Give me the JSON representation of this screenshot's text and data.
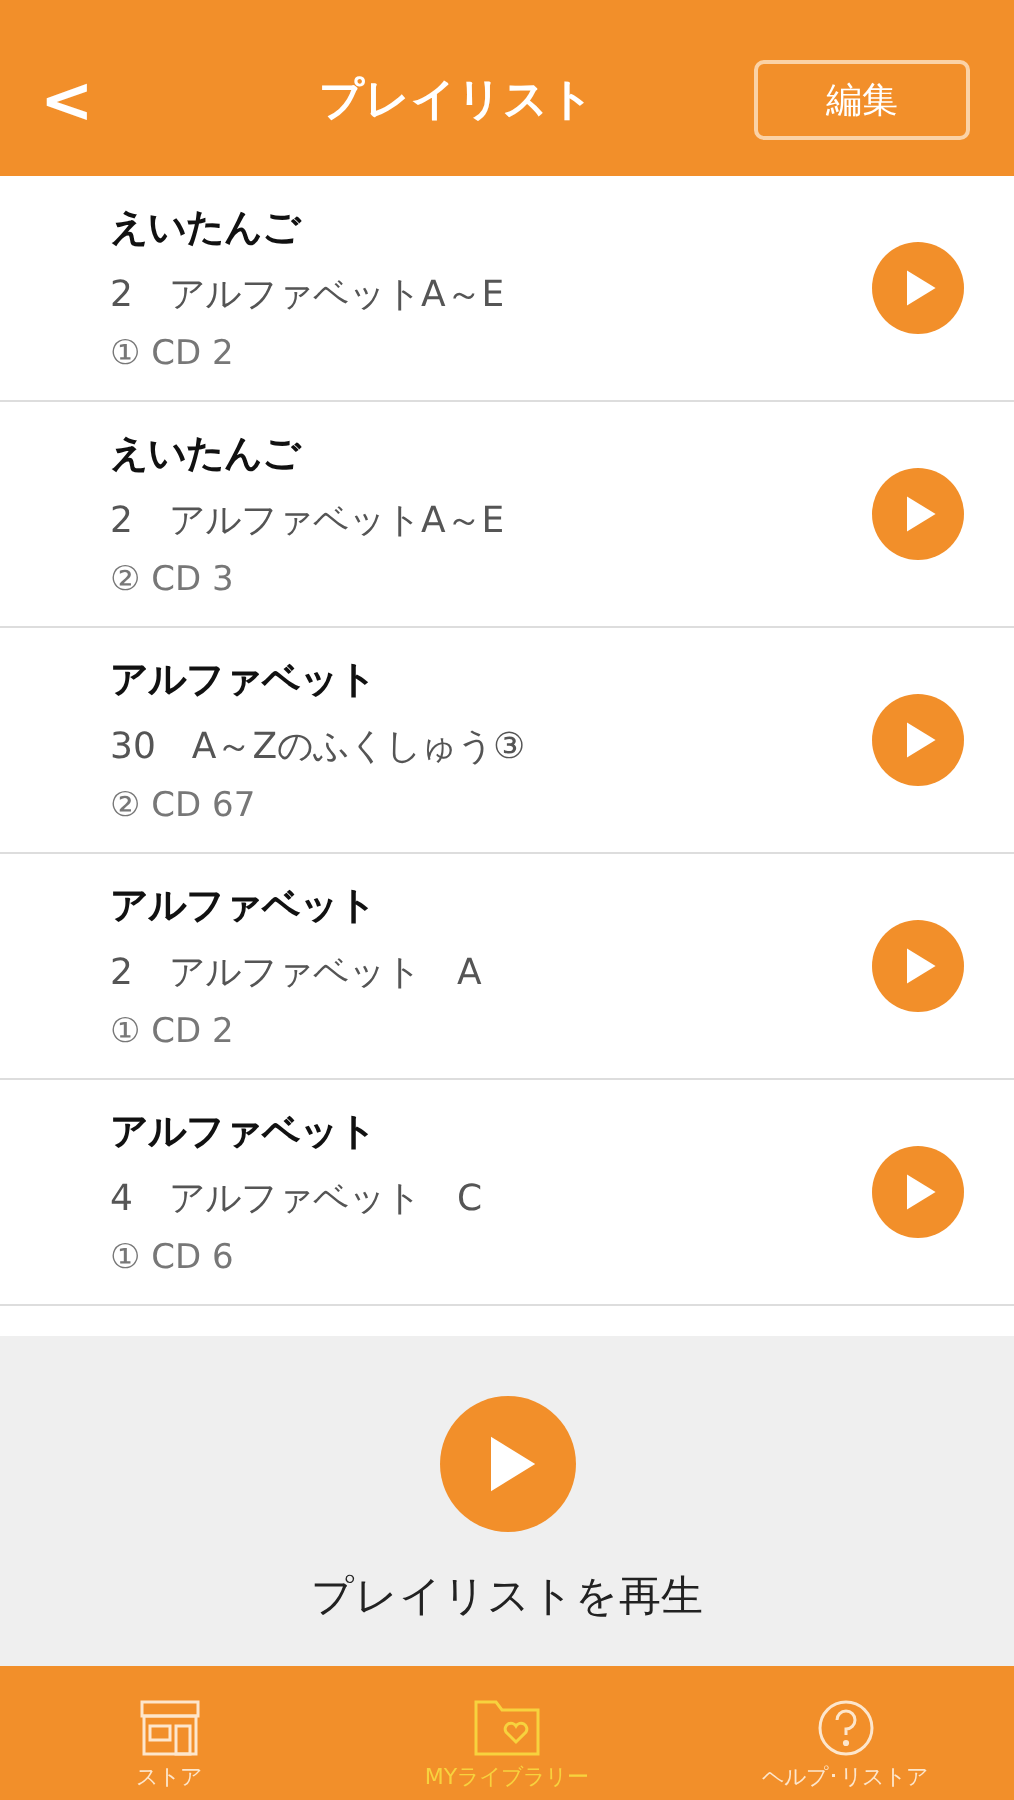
{
  "header": {
    "back": "<",
    "title": "プレイリスト",
    "edit": "編集"
  },
  "tracks": [
    {
      "album": "えいたんご",
      "track": "2　アルファベットA～E",
      "cd": "① CD 2"
    },
    {
      "album": "えいたんご",
      "track": "2　アルファベットA～E",
      "cd": "② CD 3"
    },
    {
      "album": "アルファベット",
      "track": "30　A～Zのふくしゅう③",
      "cd": "② CD 67"
    },
    {
      "album": "アルファベット",
      "track": "2　アルファベット　A",
      "cd": "① CD 2"
    },
    {
      "album": "アルファベット",
      "track": "4　アルファベット　C",
      "cd": "① CD 6"
    }
  ],
  "play_all": {
    "label": "プレイリストを再生"
  },
  "tab_bar": [
    {
      "kind": "store",
      "label": "ストア",
      "selected": false
    },
    {
      "kind": "library",
      "label": "MYライブラリー",
      "selected": true
    },
    {
      "kind": "help",
      "label": "ヘルプ･リストア",
      "selected": false
    }
  ]
}
